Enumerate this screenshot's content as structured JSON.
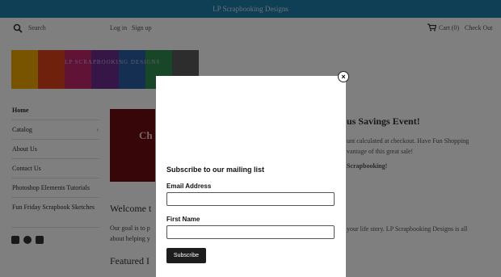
{
  "announcement": "LP Scrapbooking Designs",
  "header": {
    "search_label": "Search",
    "login": "Log in",
    "signup": "Sign up",
    "cart": "Cart (0)",
    "checkout": "Check Out"
  },
  "logo_text": "LP SCRAPBOOKING DESIGNS",
  "logo_colors": [
    "#f2a900",
    "#e0421c",
    "#c3266b",
    "#6c2d8c",
    "#2b5ea7",
    "#2f8f4e",
    "#5a5a5a"
  ],
  "sidebar": {
    "items": [
      {
        "label": "Home"
      },
      {
        "label": "Catalog"
      },
      {
        "label": "About Us"
      },
      {
        "label": "Contact Us"
      },
      {
        "label": "Photoshop Elements Tutorials"
      },
      {
        "label": "Fun Friday Scrapbook Sketches"
      }
    ]
  },
  "hero_text": "Ch",
  "welcome_heading": "Welcome t",
  "welcome_body_1": "Our goal is to p",
  "welcome_body_2": "about helping y",
  "featured_heading": "Featured I",
  "right": {
    "heading": "us Savings Event!",
    "line1": "unt calculated at checkout. Have Fun Shopping",
    "line2": "vantage of this great sale!",
    "line3": "Scrapbooking!",
    "line4": "your life story. LP Scrapbooking Designs is all"
  },
  "modal": {
    "title": "Subscribe to our mailing list",
    "email_label": "Email Address",
    "first_name_label": "First Name",
    "subscribe_button": "Subscribe",
    "close_symbol": "×"
  }
}
